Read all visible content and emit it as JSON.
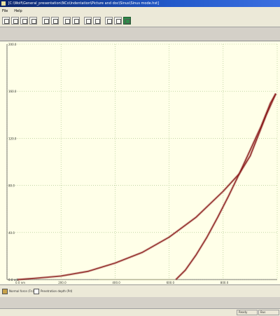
{
  "window": {
    "title": "[C:\\Wolf\\General_presentation\\NCo\\Indentation\\Picture and doc\\Sinus\\Sinus mode.hst]"
  },
  "menu": [
    "File",
    "Help"
  ],
  "toolbar": {
    "buttons": [
      "open-icon",
      "print-icon",
      "copy-icon",
      "save-icon",
      "zoom-in-icon",
      "zoom-out-icon",
      "grid-icon",
      "axis-icon",
      "fit-icon",
      "pan-icon",
      "table-icon",
      "graph-icon",
      "chart-icon"
    ],
    "active_button": "chart-icon"
  },
  "legend": {
    "items": [
      "Normal force (Fn)",
      "Penetration depth (Pd)"
    ]
  },
  "status": {
    "panes": [
      "Ready",
      "Bus"
    ]
  },
  "colors": {
    "accent": "#0a246a",
    "plot_background": "#ffffe8",
    "curve": "#8b1e1e",
    "grid": "#9fbf7f"
  },
  "chart_data": {
    "type": "line",
    "title": "",
    "xlabel": "",
    "ylabel": "",
    "xlim": [
      0,
      1000
    ],
    "ylim": [
      0,
      200
    ],
    "x_ticks": [
      "0.0 nm",
      "200.0",
      "400.0",
      "600.0",
      "800.0"
    ],
    "y_ticks": [
      "0.0 mN",
      "40.0",
      "80.0",
      "120.0",
      "160.0",
      "200.0"
    ],
    "grid": true,
    "series": [
      {
        "segment": "loading",
        "x": [
          40,
          100,
          200,
          300,
          400,
          500,
          600,
          700,
          800,
          860,
          900,
          960,
          995
        ],
        "y": [
          0,
          1,
          3,
          7,
          14,
          23,
          36,
          53,
          75,
          90,
          105,
          140,
          158
        ]
      },
      {
        "segment": "unloading",
        "x": [
          995,
          975,
          940,
          900,
          860,
          820,
          780,
          740,
          700,
          660,
          625
        ],
        "y": [
          158,
          150,
          130,
          110,
          90,
          71,
          53,
          36,
          21,
          8,
          0
        ]
      },
      {
        "segment": "baseline",
        "x": [
          340,
          620
        ],
        "y": [
          0,
          0
        ]
      }
    ]
  }
}
